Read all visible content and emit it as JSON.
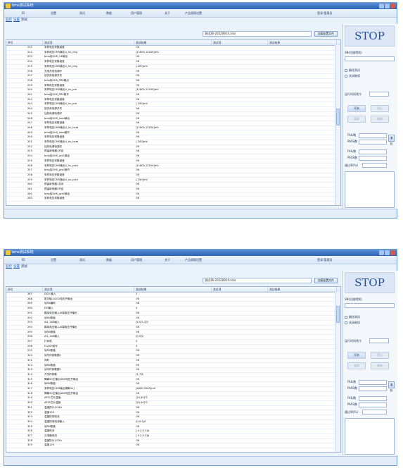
{
  "windows": [
    {
      "title": "bms测试系统",
      "menu": [
        "ID",
        "设置",
        "测试",
        "数据",
        "用户管理",
        "关于",
        "产品规格设置"
      ],
      "user_label": "登录:管理员",
      "tabs": [
        "监控",
        "设置",
        "测试"
      ],
      "file_name": "测试36-20220914.xlsx",
      "load_button": "加载配置文件",
      "columns": [
        "序号",
        "测试项",
        "测试结果",
        "测试项",
        "测试结果"
      ],
      "rows": [
        [
          "231",
          "采样电压采集误差",
          "OK"
        ],
        [
          "232",
          "采样电压CMS输出U_hu_chg",
          "[11800,12200]mV"
        ],
        [
          "233",
          "bms给GHS_OK输出",
          "OK"
        ],
        [
          "234",
          "采样电压采集误差",
          "OK"
        ],
        [
          "235",
          "采样电压CMS输出U_hu_chg",
          "[-200]mV"
        ],
        [
          "236",
          "充电充电电源开",
          "OK"
        ],
        [
          "237",
          "放充电电源开关",
          "OK"
        ],
        [
          "238",
          "bms给GHS_PRE输出",
          "OK"
        ],
        [
          "239",
          "采样电压采集误差",
          "OK"
        ],
        [
          "240",
          "采样电压CMS输出U_hu_pre",
          "[11800,12200]mV"
        ],
        [
          "241",
          "bms给GHS_PRE断开",
          "OK"
        ],
        [
          "242",
          "采样电压采集误差",
          "OK"
        ],
        [
          "243",
          "采样电压CMS输出U_hu_pre",
          "[-200]mV"
        ],
        [
          "244",
          "放充电电源开关",
          "OK"
        ],
        [
          "245",
          "加热电源电源开",
          "OK"
        ],
        [
          "246",
          "bms给GHS_heat输出",
          "OK"
        ],
        [
          "247",
          "采样电压采集误差",
          "OK"
        ],
        [
          "248",
          "采样电压CMS输出U_hu_heat",
          "[11800,12200]mV"
        ],
        [
          "249",
          "bms给GHS_heat断开",
          "OK"
        ],
        [
          "250",
          "采样电压采集误差",
          "OK"
        ],
        [
          "251",
          "采样电压CMS输出U_hu_heat",
          "[-200]mV"
        ],
        [
          "252",
          "加热电源电源关",
          "OK"
        ],
        [
          "253",
          "预留继电器1开启",
          "OK"
        ],
        [
          "254",
          "bms给GHS_pre1输出",
          "OK"
        ],
        [
          "255",
          "采样电压采集误差",
          "OK"
        ],
        [
          "256",
          "采样电压CMS输出U_hu_pre1",
          "[11800,12200]mV"
        ],
        [
          "257",
          "bms给GHS_pre1断开",
          "OK"
        ],
        [
          "258",
          "采样电压采集误差",
          "OK"
        ],
        [
          "259",
          "采样电压CMS输出U_hu_pre1",
          "[-200]mV"
        ],
        [
          "260",
          "预留继电器1关闭",
          "OK"
        ],
        [
          "261",
          "预留继电器2开启",
          "OK"
        ],
        [
          "262",
          "bms给GHS_pre2输出",
          "OK"
        ],
        [
          "263",
          "采样电压采集误差",
          "OK"
        ]
      ],
      "stop": "STOP",
      "sn_label": "SN(扫描得到)",
      "check1": "最优测试",
      "check2": "关闭继续",
      "time_label": "运行时间(秒):",
      "btn_start": "开始",
      "btn_stop": "停止",
      "btn_save": "暂停",
      "btn_continue": "继续",
      "fail_label": "FAIL数",
      "pass_label": "PASS数",
      "clear_label": "清除",
      "fail_rate": "FAIL数",
      "pass_rate": "PASS数",
      "yield_label": "通过率(%)"
    },
    {
      "title": "bms测试系统",
      "menu": [
        "ID",
        "设置",
        "测试",
        "数据",
        "用户管理",
        "关于",
        "产品规格设置"
      ],
      "user_label": "登录:管理员",
      "tabs": [
        "监控",
        "设置",
        "测试"
      ],
      "file_name": "测试36-20220914.xlsx",
      "load_button": "加载配置文件",
      "columns": [
        "序号",
        "测试项",
        "测试结果",
        "测试项",
        "测试结果"
      ],
      "rows": [
        [
          "287",
          "DO2 输入",
          "1"
        ],
        [
          "288",
          "数字输入DO2电压开输出",
          "OK"
        ],
        [
          "289",
          "读SN编码",
          "OK"
        ],
        [
          "290",
          "DO输入",
          "0"
        ],
        [
          "291",
          "模拟电压输入AI端电压开输出",
          "OK"
        ],
        [
          "292",
          "读SN数值",
          "OK"
        ],
        [
          "293",
          "AI1_Volt输入",
          "[4.0,5.2]V"
        ],
        [
          "294",
          "模拟电压输入AI端电压开输出",
          "OK"
        ],
        [
          "295",
          "读SN数值",
          "OK"
        ],
        [
          "296",
          "AI1_Volt输入",
          "[0,0]V"
        ],
        [
          "297",
          "打印机",
          "0"
        ],
        [
          "298",
          "FLASH读写",
          "0"
        ],
        [
          "299",
          "读SN数值",
          "OK"
        ],
        [
          "310",
          "读写时钟数据1",
          "OK"
        ],
        [
          "311",
          "同时",
          "OK"
        ],
        [
          "312",
          "读SN数值",
          "OK"
        ],
        [
          "313",
          "读写时钟数据1",
          "OK"
        ],
        [
          "314",
          "开关时钟数",
          "[1,7]S"
        ],
        [
          "315",
          "隔离5V正输出ADS电压开输出",
          "OK"
        ],
        [
          "316",
          "读SN数值",
          "OK"
        ],
        [
          "317",
          "采样电压CMS输出隔离5V]",
          "[4800,5500]mV"
        ],
        [
          "318",
          "隔离5V正输出ADS电压开输出",
          "OK"
        ],
        [
          "319",
          "AFE1芯片温度",
          "[20,40]℃"
        ],
        [
          "320",
          "AFE2芯片温度",
          "[20,40]℃"
        ],
        [
          "321",
          "温度探头1/16A",
          "OK"
        ],
        [
          "322",
          "温度125",
          "OK"
        ],
        [
          "323",
          "温度探测电流",
          "OK"
        ],
        [
          "324",
          "温度探测电流输入",
          "[0,0.2]A"
        ],
        [
          "325",
          "读SN数值",
          "OK"
        ],
        [
          "326",
          "温度电流",
          "[-0.2,0.2]A"
        ],
        [
          "327",
          "分流器电流",
          "[-0.2,0.2]A"
        ],
        [
          "328",
          "温度探头1/32A",
          "OK"
        ],
        [
          "329",
          "温度125",
          "OK"
        ]
      ],
      "stop": "STOP",
      "sn_label": "SN(扫描得到)",
      "check1": "最优测试",
      "check2": "关闭继续",
      "time_label": "运行时间(秒):",
      "btn_start": "开始",
      "btn_stop": "停止",
      "btn_save": "暂停",
      "btn_continue": "继续",
      "fail_label": "FAIL数",
      "pass_label": "PASS数",
      "clear_label": "清除",
      "fail_rate": "FAIL数",
      "pass_rate": "PASS数",
      "yield_label": "通过率(%)"
    }
  ]
}
